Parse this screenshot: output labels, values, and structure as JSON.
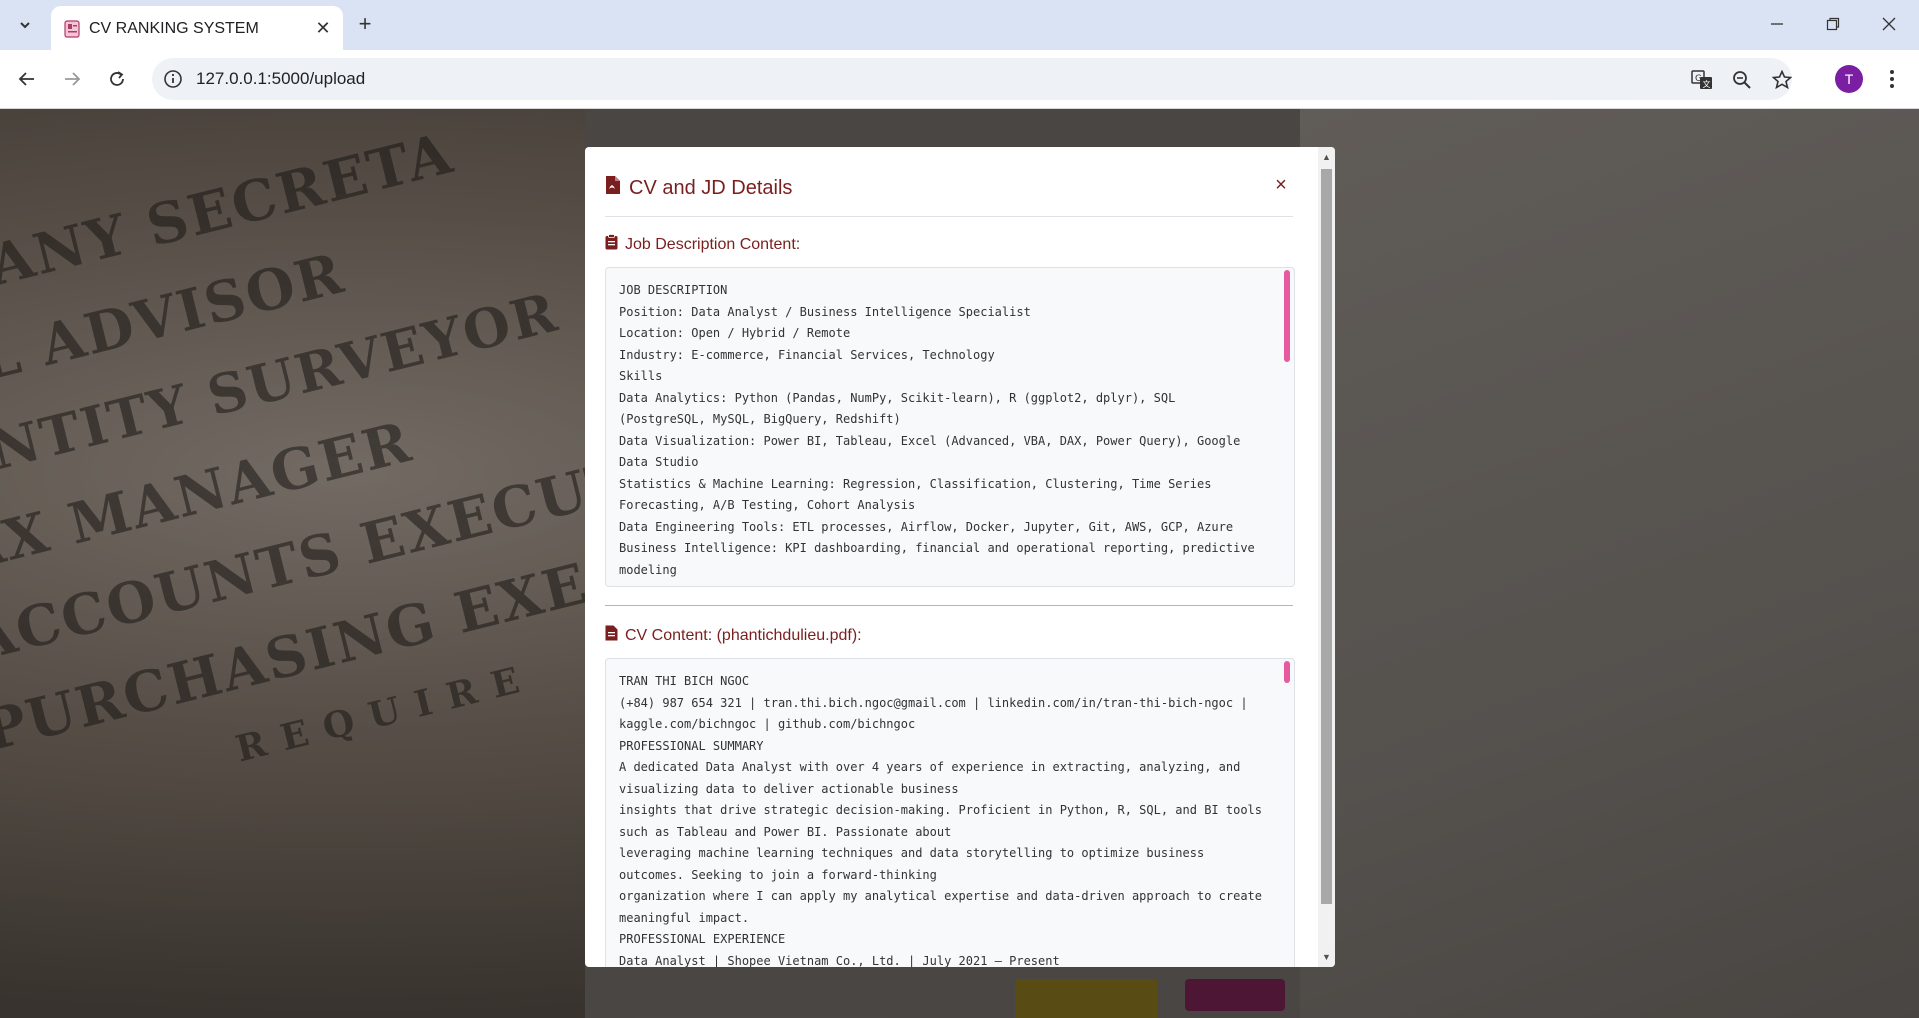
{
  "browser": {
    "tab_title": "CV RANKING SYSTEM",
    "url": "127.0.0.1:5000/upload",
    "profile_initial": "T"
  },
  "background": {
    "words": [
      "IPANY SECRETA",
      "AL ADVISOR",
      "ANTITY SURVEYOR",
      "AX MANAGER",
      "ACCOUNTS EXECUT",
      "PURCHASING EXEC",
      "REQUIRE"
    ]
  },
  "modal": {
    "title": "CV and JD Details",
    "jd_heading": "Job Description Content:",
    "jd_text": "JOB DESCRIPTION\nPosition: Data Analyst / Business Intelligence Specialist\nLocation: Open / Hybrid / Remote\nIndustry: E-commerce, Financial Services, Technology\nSkills\nData Analytics: Python (Pandas, NumPy, Scikit-learn), R (ggplot2, dplyr), SQL (PostgreSQL, MySQL, BigQuery, Redshift)\nData Visualization: Power BI, Tableau, Excel (Advanced, VBA, DAX, Power Query), Google Data Studio\nStatistics & Machine Learning: Regression, Classification, Clustering, Time Series Forecasting, A/B Testing, Cohort Analysis\nData Engineering Tools: ETL processes, Airflow, Docker, Jupyter, Git, AWS, GCP, Azure\nBusiness Intelligence: KPI dashboarding, financial and operational reporting, predictive modeling",
    "cv_heading": "CV Content: (phantichdulieu.pdf):",
    "cv_text": "TRAN THI BICH NGOC\n(+84) 987 654 321 | tran.thi.bich.ngoc@gmail.com | linkedin.com/in/tran-thi-bich-ngoc | kaggle.com/bichngoc | github.com/bichngoc\nPROFESSIONAL SUMMARY\nA dedicated Data Analyst with over 4 years of experience in extracting, analyzing, and visualizing data to deliver actionable business\ninsights that drive strategic decision-making. Proficient in Python, R, SQL, and BI tools such as Tableau and Power BI. Passionate about\nleveraging machine learning techniques and data storytelling to optimize business outcomes. Seeking to join a forward-thinking\norganization where I can apply my analytical expertise and data-driven approach to create meaningful impact.\nPROFESSIONAL EXPERIENCE\nData Analyst | Shopee Vietnam Co., Ltd. | July 2021 – Present"
  }
}
